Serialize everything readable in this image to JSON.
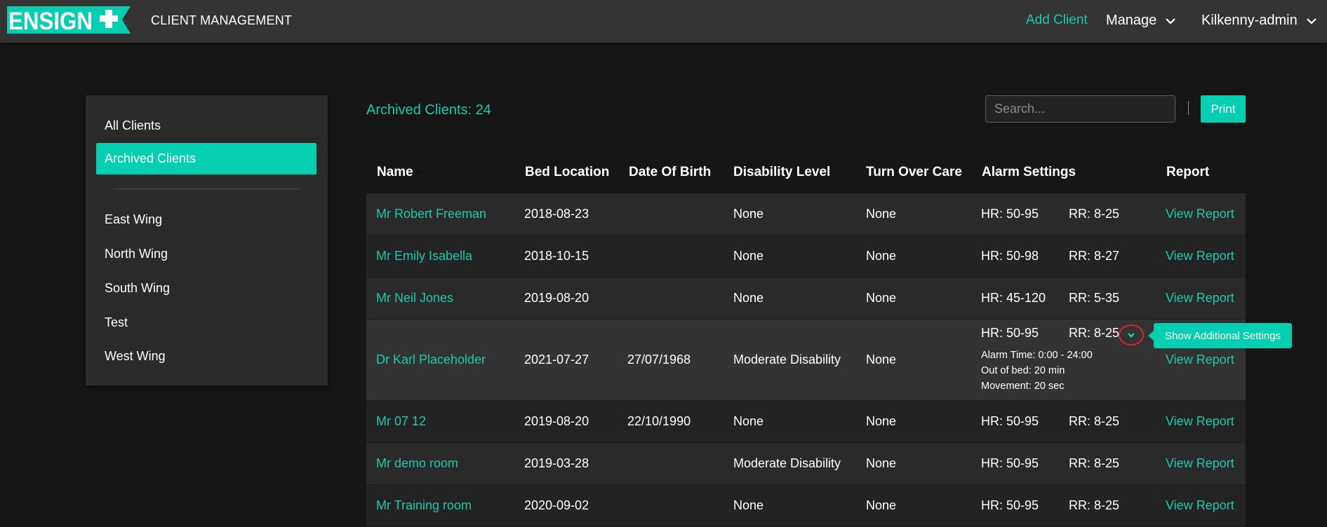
{
  "header": {
    "logo_text": "ENSIGN",
    "app_title": "CLIENT MANAGEMENT",
    "add_client": "Add Client",
    "manage": "Manage",
    "user": "Kilkenny-admin"
  },
  "sidebar": {
    "items": [
      "All Clients",
      "Archived Clients",
      "East Wing",
      "North Wing",
      "South Wing",
      "Test",
      "West Wing"
    ],
    "active": "Archived Clients"
  },
  "main": {
    "archived_label": "Archived Clients: 24",
    "search_placeholder": "Search...",
    "print_label": "Print"
  },
  "table": {
    "columns": [
      "Name",
      "Bed Location",
      "Date Of Birth",
      "Disability Level",
      "Turn Over Care",
      "Alarm Settings",
      "Report"
    ],
    "rows": [
      {
        "name": "Mr Robert Freeman",
        "bed": "2018-08-23",
        "dob": "",
        "disability": "None",
        "turnover": "None",
        "hr": "HR: 50-95",
        "rr": "RR: 8-25",
        "report": "View Report"
      },
      {
        "name": "Mr Emily Isabella",
        "bed": "2018-10-15",
        "dob": "",
        "disability": "None",
        "turnover": "None",
        "hr": "HR: 50-98",
        "rr": "RR: 8-27",
        "report": "View Report"
      },
      {
        "name": "Mr Neil Jones",
        "bed": "2019-08-20",
        "dob": "",
        "disability": "None",
        "turnover": "None",
        "hr": "HR: 45-120",
        "rr": "RR: 5-35",
        "report": "View Report"
      },
      {
        "name": "Dr Karl Placeholder",
        "bed": "2021-07-27",
        "dob": "27/07/1968",
        "disability": "Moderate Disability",
        "turnover": "None",
        "hr": "HR: 50-95",
        "rr": "RR: 8-25",
        "report": "View Report",
        "extra": [
          "Alarm Time: 0:00 - 24:00",
          "Out of bed: 20 min",
          "Movement: 20 sec"
        ]
      },
      {
        "name": "Mr 07 12",
        "bed": "2019-08-20",
        "dob": "22/10/1990",
        "disability": "None",
        "turnover": "None",
        "hr": "HR: 50-95",
        "rr": "RR: 8-25",
        "report": "View Report"
      },
      {
        "name": "Mr demo room",
        "bed": "2019-03-28",
        "dob": "",
        "disability": "Moderate Disability",
        "turnover": "None",
        "hr": "HR: 50-95",
        "rr": "RR: 8-25",
        "report": "View Report"
      },
      {
        "name": "Mr Training room",
        "bed": "2020-09-02",
        "dob": "",
        "disability": "None",
        "turnover": "None",
        "hr": "HR: 50-95",
        "rr": "RR: 8-25",
        "report": "View Report"
      }
    ]
  },
  "tooltip": {
    "text": "Show Additional Settings"
  },
  "colors": {
    "accent": "#05ceb1",
    "link": "#1fc9ab",
    "topbar": "#343434",
    "background": "#161616",
    "highlight_ring": "#e0212d"
  }
}
